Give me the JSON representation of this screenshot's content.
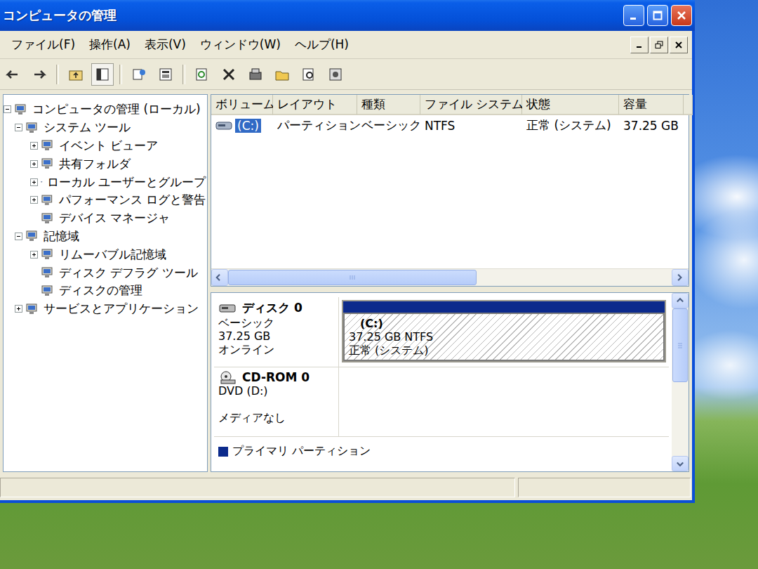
{
  "window": {
    "title": "コンピュータの管理"
  },
  "menu": [
    "ファイル(F)",
    "操作(A)",
    "表示(V)",
    "ウィンドウ(W)",
    "ヘルプ(H)"
  ],
  "tree": [
    {
      "label": "コンピュータの管理 (ローカル)",
      "level": 0,
      "expandable": true,
      "expanded": true,
      "selected": false
    },
    {
      "label": "システム ツール",
      "level": 1,
      "expandable": true,
      "expanded": true,
      "selected": false
    },
    {
      "label": "イベント ビューア",
      "level": 2,
      "expandable": true,
      "expanded": false,
      "selected": false
    },
    {
      "label": "共有フォルダ",
      "level": 2,
      "expandable": true,
      "expanded": false,
      "selected": false
    },
    {
      "label": "ローカル ユーザーとグループ",
      "level": 2,
      "expandable": true,
      "expanded": false,
      "selected": false
    },
    {
      "label": "パフォーマンス ログと警告",
      "level": 2,
      "expandable": true,
      "expanded": false,
      "selected": false
    },
    {
      "label": "デバイス マネージャ",
      "level": 2,
      "expandable": false,
      "expanded": false,
      "selected": false
    },
    {
      "label": "記憶域",
      "level": 1,
      "expandable": true,
      "expanded": true,
      "selected": false
    },
    {
      "label": "リムーバブル記憶域",
      "level": 2,
      "expandable": true,
      "expanded": false,
      "selected": false
    },
    {
      "label": "ディスク デフラグ ツール",
      "level": 2,
      "expandable": false,
      "expanded": false,
      "selected": false
    },
    {
      "label": "ディスクの管理",
      "level": 2,
      "expandable": false,
      "expanded": false,
      "selected": false
    },
    {
      "label": "サービスとアプリケーション",
      "level": 1,
      "expandable": true,
      "expanded": false,
      "selected": false
    }
  ],
  "table": {
    "columns": [
      "ボリューム",
      "レイアウト",
      "種類",
      "ファイル システム",
      "状態",
      "容量"
    ],
    "rows": [
      {
        "cells": [
          "(C:)",
          "パーティション",
          "ベーシック",
          "NTFS",
          "正常 (システム)",
          "37.25 GB"
        ],
        "selected": true
      }
    ]
  },
  "list_scroll": {
    "level": 0.56
  },
  "disks": [
    {
      "kind": "disk",
      "name": "ディスク 0",
      "lines": [
        "ベーシック",
        "37.25 GB",
        "オンライン"
      ],
      "partitions": [
        {
          "label": "(C:)",
          "size": "37.25 GB NTFS",
          "status": "正常 (システム)",
          "color": "#0c2a8c",
          "selected": true
        }
      ]
    },
    {
      "kind": "cdrom",
      "name": "CD-ROM 0",
      "lines": [
        "DVD (D:)",
        "",
        "メディアなし"
      ],
      "partitions": []
    }
  ],
  "map_scroll": {
    "level": 0.5
  },
  "legend": [
    {
      "label": "プライマリ パーティション",
      "color": "#0c2a8c"
    }
  ]
}
